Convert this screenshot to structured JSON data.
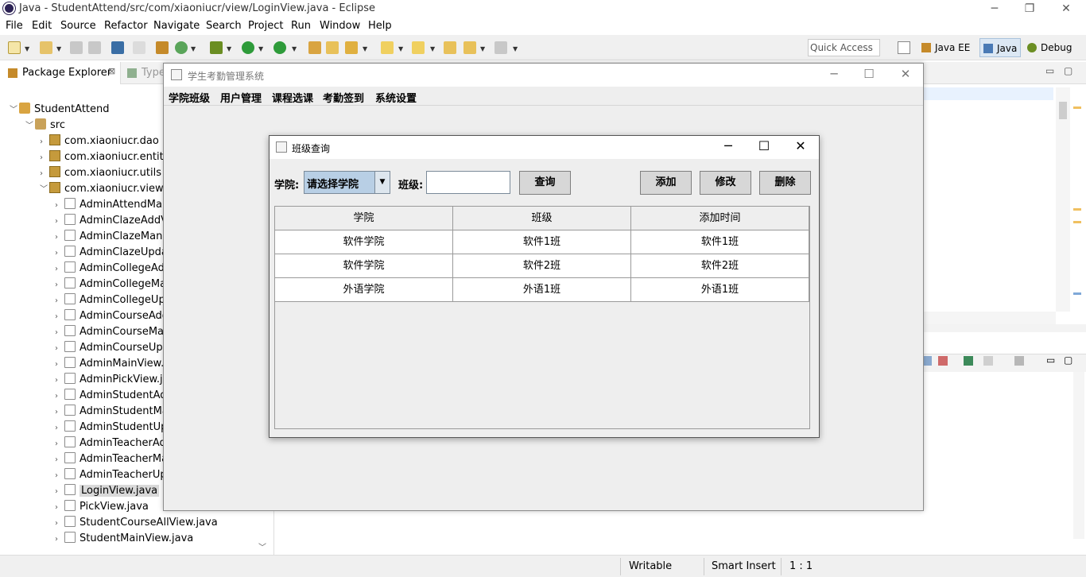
{
  "window": {
    "title": "Java - StudentAttend/src/com/xiaoniucr/view/LoginView.java - Eclipse"
  },
  "menu": [
    "File",
    "Edit",
    "Source",
    "Refactor",
    "Navigate",
    "Search",
    "Project",
    "Run",
    "Window",
    "Help"
  ],
  "quick_access": "Quick Access",
  "perspectives": [
    "Java EE",
    "Java",
    "Debug"
  ],
  "left_tabs": {
    "package_explorer": "Package Explorer",
    "type": "Type"
  },
  "tree": {
    "project": "StudentAttend",
    "src": "src",
    "packages": [
      "com.xiaoniucr.dao",
      "com.xiaoniucr.entity",
      "com.xiaoniucr.utils",
      "com.xiaoniucr.view"
    ],
    "files": [
      "AdminAttendMan",
      "AdminClazeAddV",
      "AdminClazeMana",
      "AdminClazeUpda",
      "AdminCollegeAdc",
      "AdminCollegeMa",
      "AdminCollegeUpc",
      "AdminCourseAdd",
      "AdminCourseMar",
      "AdminCourseUpc",
      "AdminMainView.j",
      "AdminPickView.ja",
      "AdminStudentAdc",
      "AdminStudentMa",
      "AdminStudentUpc",
      "AdminTeacherAd",
      "AdminTeacherMa",
      "AdminTeacherUp",
      "LoginView.java",
      "PickView.java",
      "StudentCourseAllView.java",
      "StudentMainView.java"
    ]
  },
  "status": {
    "writable": "Writable",
    "insert": "Smart Insert",
    "pos": "1 : 1"
  },
  "app": {
    "title": "学生考勤管理系统",
    "menus": [
      "学院班级",
      "用户管理",
      "课程选课",
      "考勤签到",
      "系统设置"
    ]
  },
  "dialog": {
    "title": "班级查询",
    "college_label": "学院:",
    "college_value": "请选择学院",
    "class_label": "班级:",
    "class_value": "",
    "buttons": {
      "query": "查询",
      "add": "添加",
      "edit": "修改",
      "delete": "删除"
    },
    "table": {
      "headers": [
        "学院",
        "班级",
        "添加时间"
      ],
      "rows": [
        [
          "软件学院",
          "软件1班",
          "软件1班"
        ],
        [
          "软件学院",
          "软件2班",
          "软件2班"
        ],
        [
          "外语学院",
          "外语1班",
          "外语1班"
        ]
      ]
    }
  }
}
